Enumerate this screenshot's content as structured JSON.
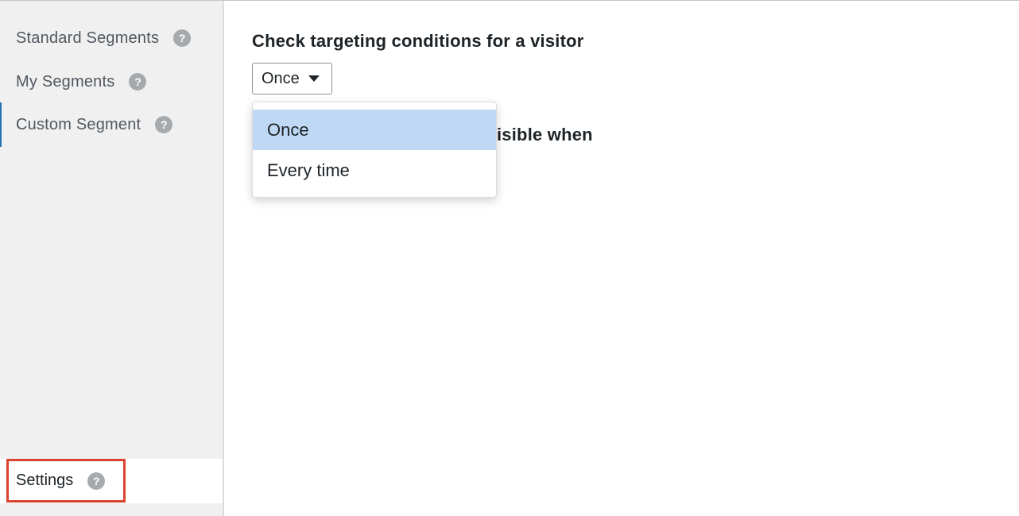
{
  "sidebar": {
    "items": [
      {
        "label": "Standard Segments",
        "icon": "help-icon"
      },
      {
        "label": "My Segments",
        "icon": "help-icon"
      },
      {
        "label": "Custom Segment",
        "icon": "help-icon"
      }
    ],
    "settings": {
      "label": "Settings",
      "icon": "help-icon"
    },
    "help_glyph": "?"
  },
  "main": {
    "heading": "Check targeting conditions for a visitor",
    "select": {
      "value": "Once",
      "options": [
        "Once",
        "Every time"
      ]
    },
    "heading2": "isible when"
  },
  "colors": {
    "highlight": "#d9432f",
    "selected_option": "#bfd8f3",
    "sidebar_bg": "#f0f0f1",
    "active_border": "#2271b1"
  }
}
